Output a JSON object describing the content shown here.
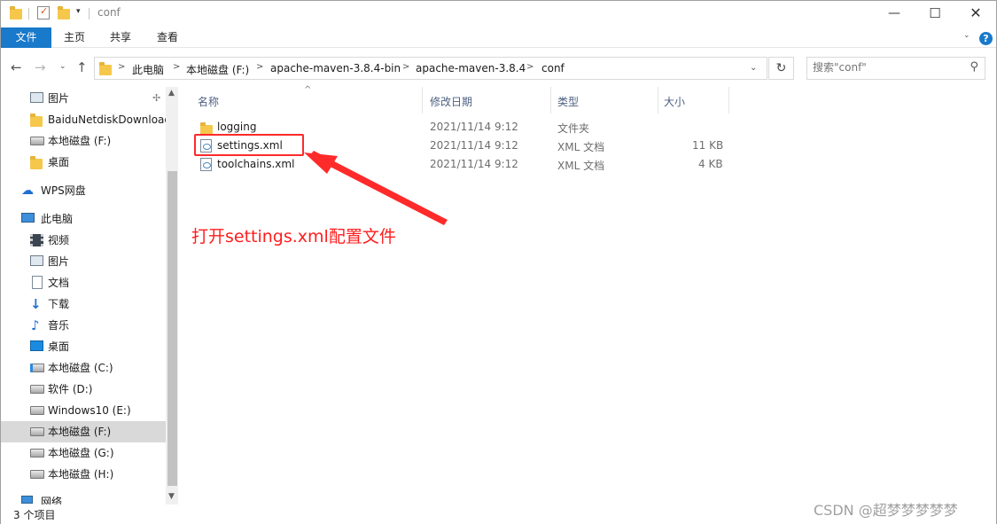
{
  "window": {
    "title": "conf"
  },
  "ribbon": {
    "tabs": [
      "文件",
      "主页",
      "共享",
      "查看"
    ],
    "help": "?"
  },
  "address": {
    "crumbs": [
      "此电脑",
      "本地磁盘 (F:)",
      "apache-maven-3.8.4-bin",
      "apache-maven-3.8.4",
      "conf"
    ]
  },
  "search": {
    "placeholder": "搜索\"conf\""
  },
  "sidebar": {
    "items": [
      {
        "label": "图片",
        "icon": "picture-icon",
        "pinned": true
      },
      {
        "label": "BaiduNetdiskDownload",
        "icon": "folder-icon"
      },
      {
        "label": "本地磁盘 (F:)",
        "icon": "drive-icon"
      },
      {
        "label": "桌面",
        "icon": "folder-icon"
      },
      {
        "label": "WPS网盘",
        "icon": "cloud-icon"
      },
      {
        "label": "此电脑",
        "icon": "computer-icon"
      },
      {
        "label": "视频",
        "icon": "video-icon"
      },
      {
        "label": "图片",
        "icon": "picture-icon"
      },
      {
        "label": "文档",
        "icon": "document-icon"
      },
      {
        "label": "下载",
        "icon": "download-icon"
      },
      {
        "label": "音乐",
        "icon": "music-icon"
      },
      {
        "label": "桌面",
        "icon": "desktop-icon"
      },
      {
        "label": "本地磁盘 (C:)",
        "icon": "system-drive-icon"
      },
      {
        "label": "软件 (D:)",
        "icon": "drive-icon"
      },
      {
        "label": "Windows10 (E:)",
        "icon": "drive-icon"
      },
      {
        "label": "本地磁盘 (F:)",
        "icon": "drive-icon",
        "selected": true
      },
      {
        "label": "本地磁盘 (G:)",
        "icon": "drive-icon"
      },
      {
        "label": "本地磁盘 (H:)",
        "icon": "drive-icon"
      },
      {
        "label": "网络",
        "icon": "network-icon"
      }
    ]
  },
  "columns": {
    "name": "名称",
    "modified": "修改日期",
    "type": "类型",
    "size": "大小"
  },
  "files": [
    {
      "name": "logging",
      "modified": "2021/11/14 9:12",
      "type": "文件夹",
      "size": "",
      "icon": "folder-icon"
    },
    {
      "name": "settings.xml",
      "modified": "2021/11/14 9:12",
      "type": "XML 文档",
      "size": "11 KB",
      "icon": "xml-file-icon"
    },
    {
      "name": "toolchains.xml",
      "modified": "2021/11/14 9:12",
      "type": "XML 文档",
      "size": "4 KB",
      "icon": "xml-file-icon"
    }
  ],
  "annotation": {
    "text": "打开settings.xml配置文件",
    "color": "#ff1d1d"
  },
  "status": {
    "text": "3 个项目"
  },
  "watermark": {
    "text": "CSDN @超梦梦梦梦梦"
  },
  "colors": {
    "accent": "#1979ca",
    "selected_nav": "#d9d9d9"
  }
}
